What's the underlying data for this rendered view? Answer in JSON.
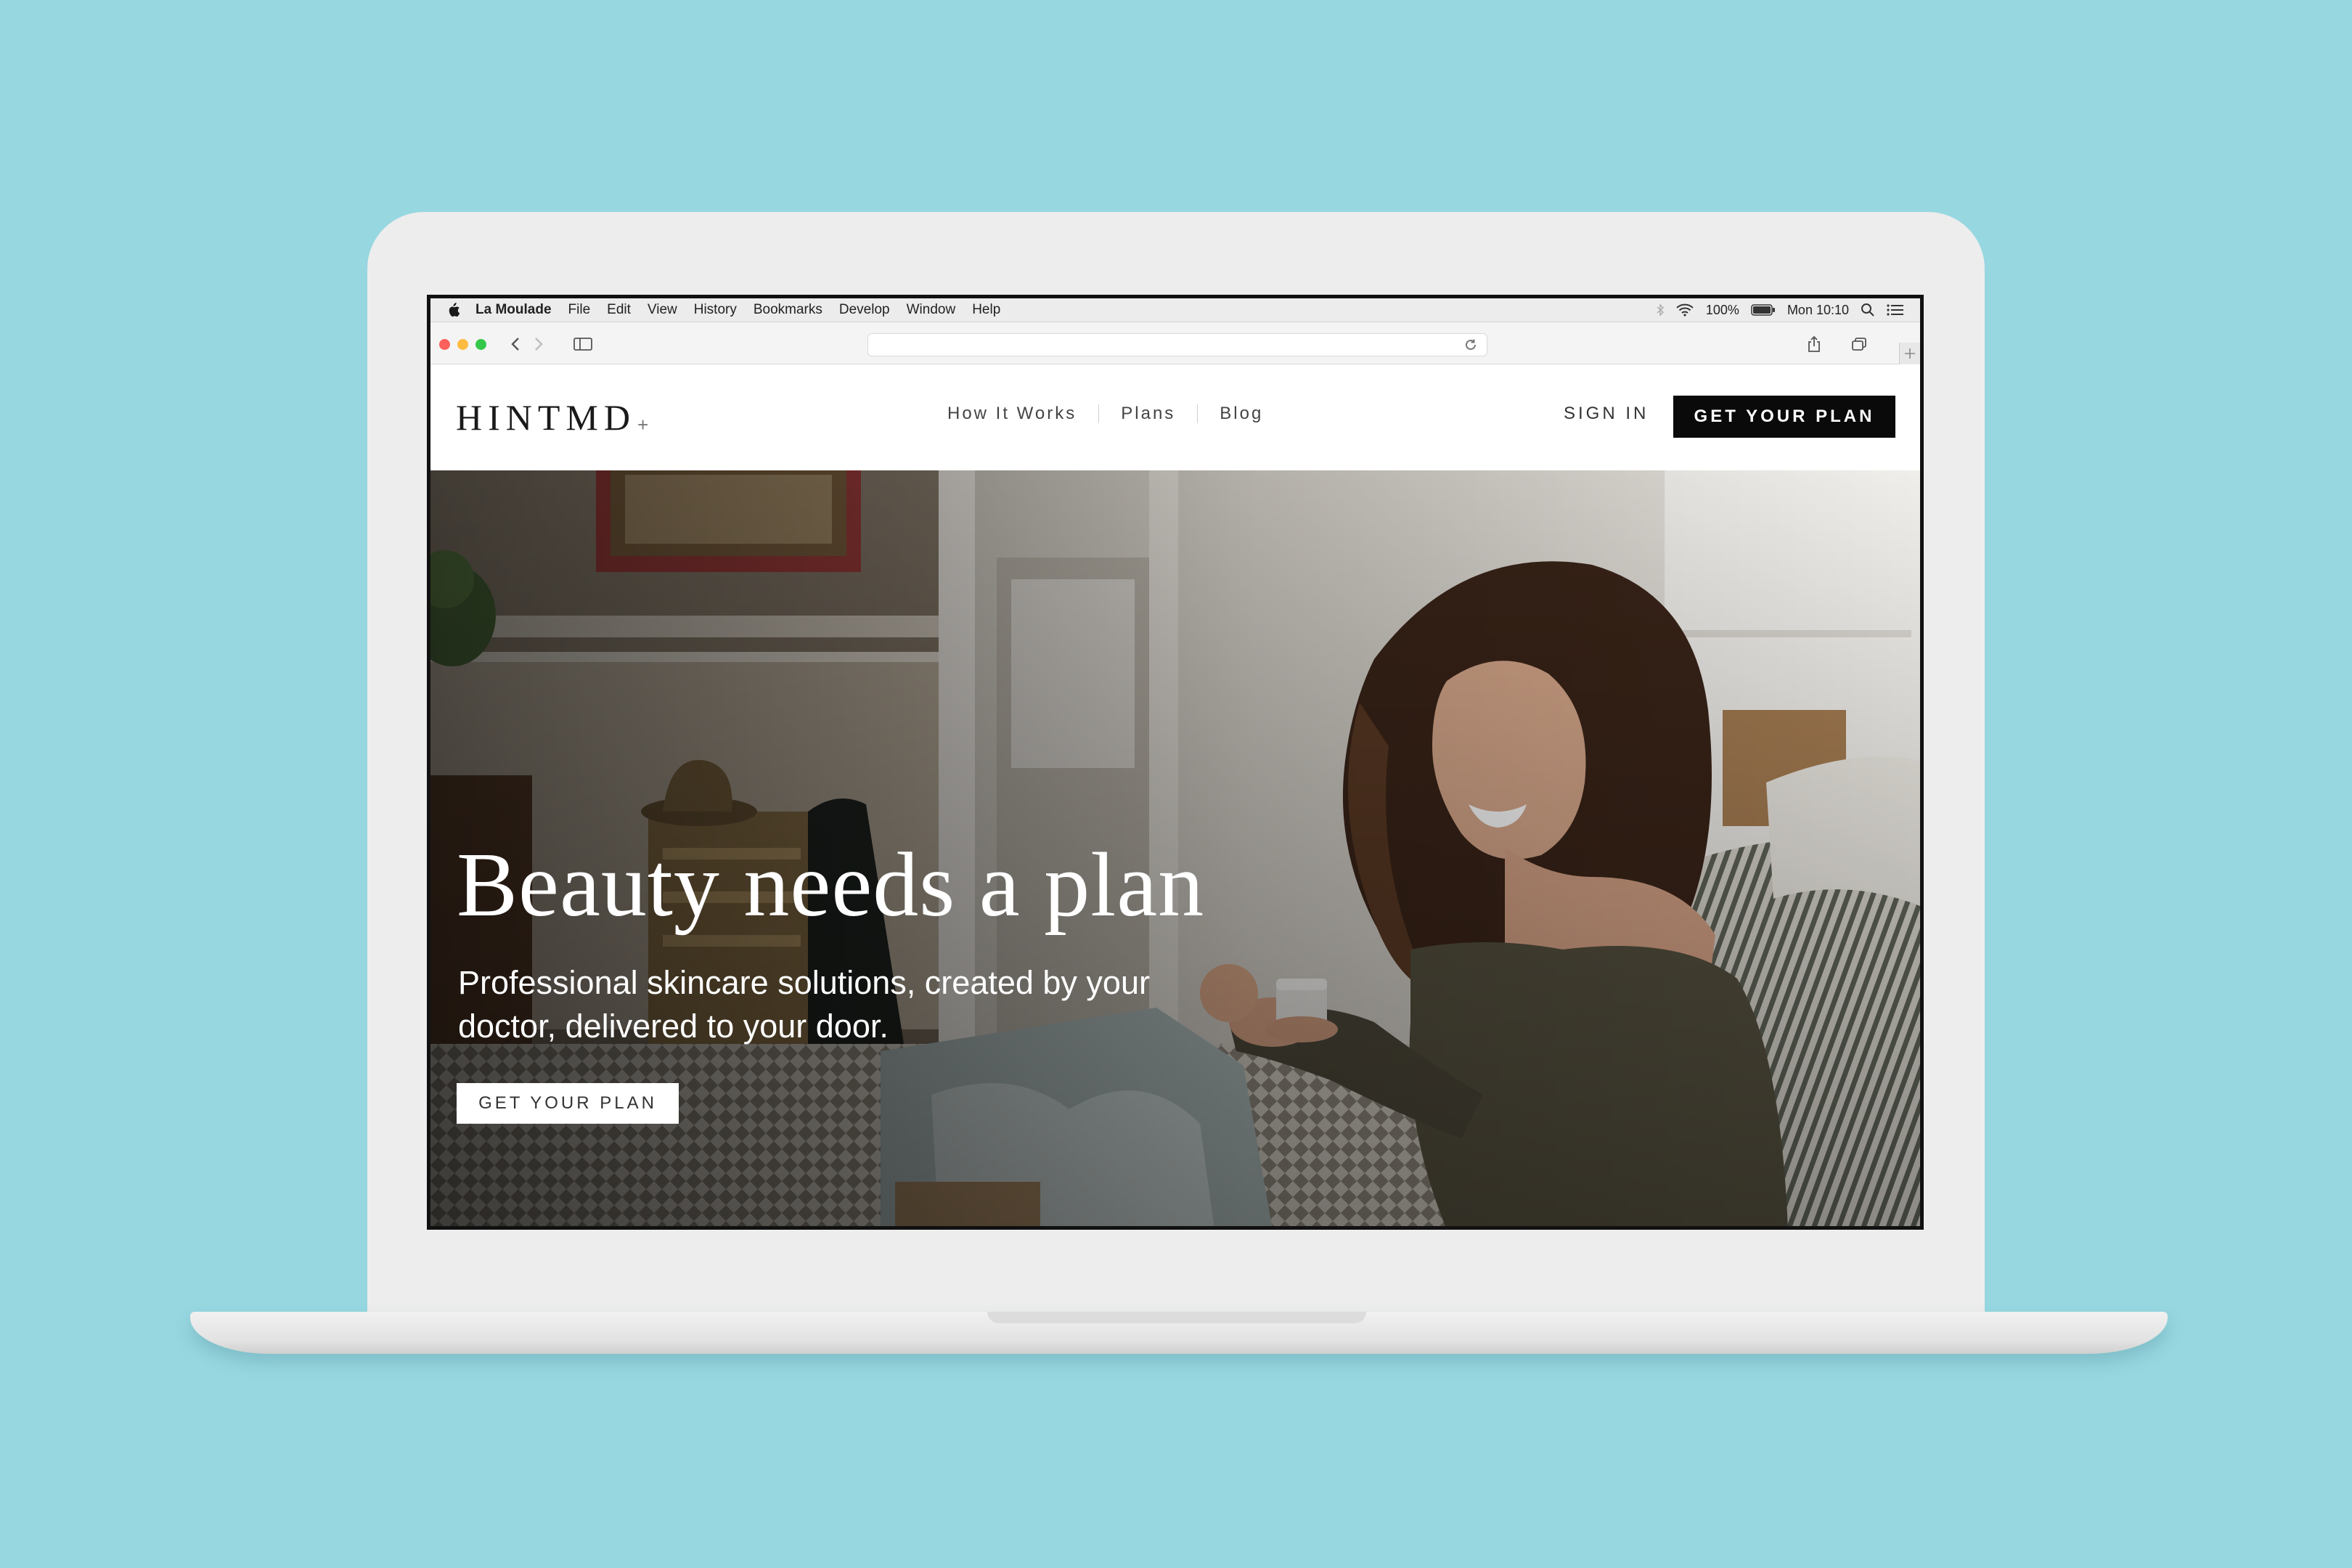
{
  "os_menubar": {
    "app_name": "La Moulade",
    "menus": [
      "File",
      "Edit",
      "View",
      "History",
      "Bookmarks",
      "Develop",
      "Window",
      "Help"
    ],
    "battery": "100%",
    "clock": "Mon 10:10"
  },
  "site": {
    "logo": "HINTMD",
    "logo_mark": "+",
    "nav": [
      "How It Works",
      "Plans",
      "Blog"
    ],
    "sign_in": "SIGN IN",
    "header_cta": "GET YOUR PLAN"
  },
  "hero": {
    "title": "Beauty needs a plan",
    "subtitle": "Professional skincare solutions, created by your doctor, delivered to your door.",
    "cta": "GET YOUR PLAN"
  },
  "colors": {
    "background": "#97d7e0",
    "header_cta_bg": "#0a0a0a",
    "hero_cta_bg": "#ffffff"
  }
}
